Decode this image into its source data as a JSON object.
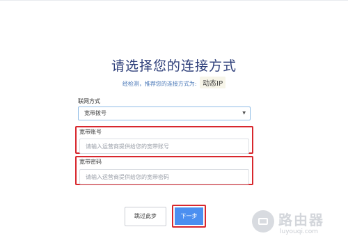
{
  "page": {
    "title": "请选择您的连接方式",
    "detect_prefix": "经检测，推荐您的连接方式为:",
    "detected_type": "动态IP"
  },
  "form": {
    "conn_type_label": "联网方式",
    "conn_type_value": "宽带拨号",
    "account_label": "宽带账号",
    "account_placeholder": "请输入运营商提供给您的宽带账号",
    "password_label": "宽带密码",
    "password_placeholder": "请输入运营商提供给您的宽带密码"
  },
  "buttons": {
    "skip_label": "跳过此步",
    "next_label": "下一步"
  },
  "watermark": {
    "title": "路由器",
    "url": "luyouqi.com"
  },
  "colors": {
    "accent_blue": "#4b8ff0",
    "highlight_red": "#d8272d",
    "title_navy": "#2e3f7a"
  }
}
